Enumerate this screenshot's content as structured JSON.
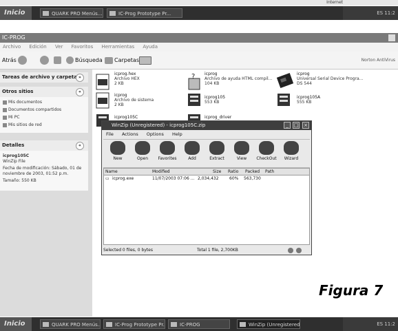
{
  "top_strip": {
    "label": "Internet"
  },
  "taskbar_top": {
    "start": "Inicio",
    "buttons": [
      "QUARK PRO  Menús...",
      "IC-Prog Prototype Pr..."
    ],
    "clock": "ES  11:2"
  },
  "explorer": {
    "title": "IC-PROG",
    "menu": [
      "Archivo",
      "Edición",
      "Ver",
      "Favoritos",
      "Herramientas",
      "Ayuda"
    ],
    "toolbar": {
      "back": "Atrás",
      "search": "Búsqueda",
      "folders": "Carpetas",
      "right": "Norton AntiVirus"
    },
    "tasks_title": "Tareas de archivo y carpeta",
    "places_title": "Otros sitios",
    "places": [
      "Mis documentos",
      "Documentos compartidos",
      "Mi PC",
      "Mis sitios de red"
    ],
    "details_title": "Detalles",
    "details": [
      "icprog105C",
      "WinZip File",
      "Fecha de modificación: Sábado, 01 de",
      "noviembre de 2003, 01:52 p.m.",
      "Tamaño: 550 KB"
    ],
    "files": [
      {
        "name": "icprog.hex",
        "type": "Archivo HEX",
        "size": "2 KB"
      },
      {
        "name": "icprog",
        "type": "Archivo de ayuda HTML compil...",
        "size": "104 KB"
      },
      {
        "name": "icprog",
        "type": "Universal Serial Device Progra...",
        "size": "DS 544"
      },
      {
        "name": "icprog",
        "type": "Archivo de sistema",
        "size": "2 KB"
      },
      {
        "name": "icprog105",
        "type": "553 KB",
        "size": ""
      },
      {
        "name": "icprog105A",
        "type": "555 KB",
        "size": ""
      },
      {
        "name": "icprog105C",
        "type": "",
        "size": ""
      },
      {
        "name": "icprog_driver",
        "type": "",
        "size": ""
      }
    ]
  },
  "winzip": {
    "title": "WinZip (Unregistered) - icprog105C.zip",
    "menu": [
      "File",
      "Actions",
      "Options",
      "Help"
    ],
    "tools": [
      "New",
      "Open",
      "Favorites",
      "Add",
      "Extract",
      "View",
      "CheckOut",
      "Wizard"
    ],
    "columns": [
      "Name",
      "Modified",
      "Size",
      "Ratio",
      "Packed",
      "Path"
    ],
    "rows": [
      {
        "name": "icprog.exe",
        "modified": "11/07/2003 07:06 ...",
        "size": "2,034,432",
        "ratio": "60%",
        "packed": "563,730",
        "path": ""
      }
    ],
    "status_left": "Selected 0 files, 0 bytes",
    "status_right": "Total 1 file, 2,700KB"
  },
  "taskbar_bottom": {
    "start": "Inicio",
    "buttons": [
      "QUARK PRO  Menús...",
      "IC-Prog Prototype Pr...",
      "IC-PROG",
      "WinZip (Unregistered)..."
    ],
    "clock": "ES  11:2"
  },
  "caption": "Figura 7"
}
